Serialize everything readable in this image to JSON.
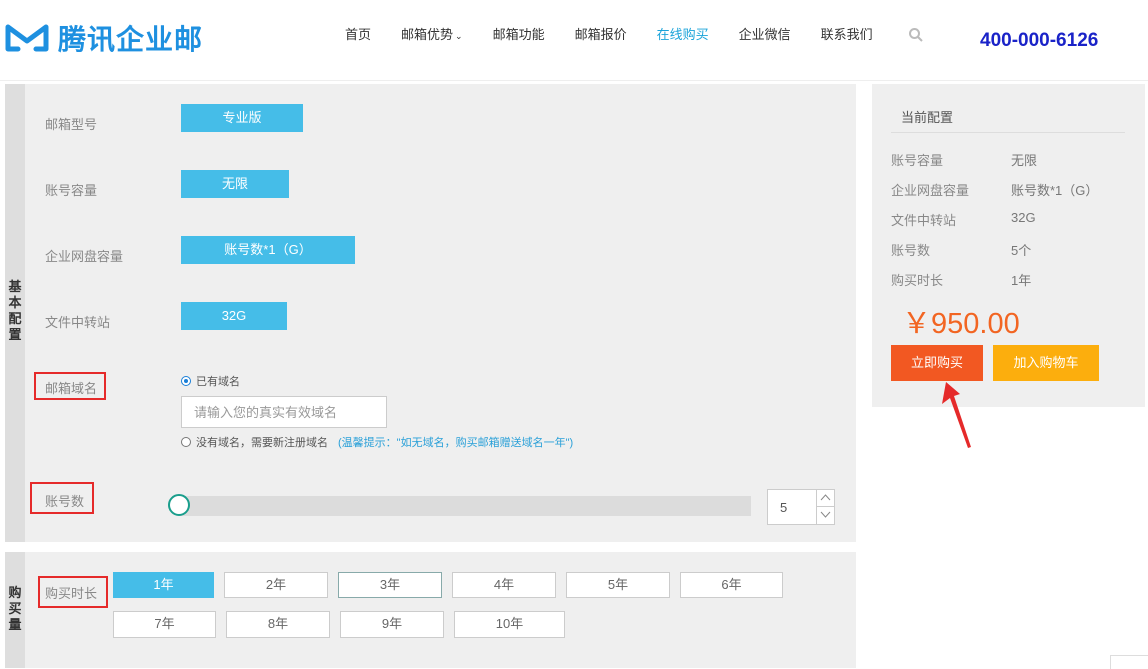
{
  "header": {
    "logo_text": "腾讯企业邮",
    "nav": [
      "首页",
      "邮箱优势",
      "邮箱功能",
      "邮箱报价",
      "在线购买",
      "企业微信",
      "联系我们"
    ],
    "active_nav": "在线购买",
    "hotline": "400-000-6126"
  },
  "basic": {
    "side_label": [
      "基",
      "本",
      "配",
      "置"
    ],
    "mailbox_type_label": "邮箱型号",
    "mailbox_type_value": "专业版",
    "capacity_label": "账号容量",
    "capacity_value": "无限",
    "disk_label": "企业网盘容量",
    "disk_value": "账号数*1（G）",
    "transfer_label": "文件中转站",
    "transfer_value": "32G",
    "domain_label": "邮箱域名",
    "domain_has": "已有域名",
    "domain_placeholder": "请输入您的真实有效域名",
    "domain_none": "没有域名，需要新注册域名",
    "domain_tip": "(温馨提示：\"如无域名，购买邮箱赠送域名一年\")",
    "accounts_label": "账号数",
    "accounts_value": "5"
  },
  "purchase": {
    "side_label": [
      "购",
      "买",
      "量"
    ],
    "duration_label": "购买时长",
    "years": [
      "1年",
      "2年",
      "3年",
      "4年",
      "5年",
      "6年",
      "7年",
      "8年",
      "9年",
      "10年"
    ],
    "selected": "1年"
  },
  "summary": {
    "title": "当前配置",
    "rows": [
      {
        "key": "账号容量",
        "val": "无限"
      },
      {
        "key": "企业网盘容量",
        "val": "账号数*1（G）"
      },
      {
        "key": "文件中转站",
        "val": "32G"
      },
      {
        "key": "账号数",
        "val": "5个"
      },
      {
        "key": "购买时长",
        "val": "1年"
      }
    ],
    "price": "￥950.00",
    "buy_label": "立即购买",
    "cart_label": "加入购物车"
  },
  "colors": {
    "accent": "#45bde8",
    "buy": "#f25822",
    "cart": "#fcae0d",
    "annotation": "#e52a2a"
  }
}
